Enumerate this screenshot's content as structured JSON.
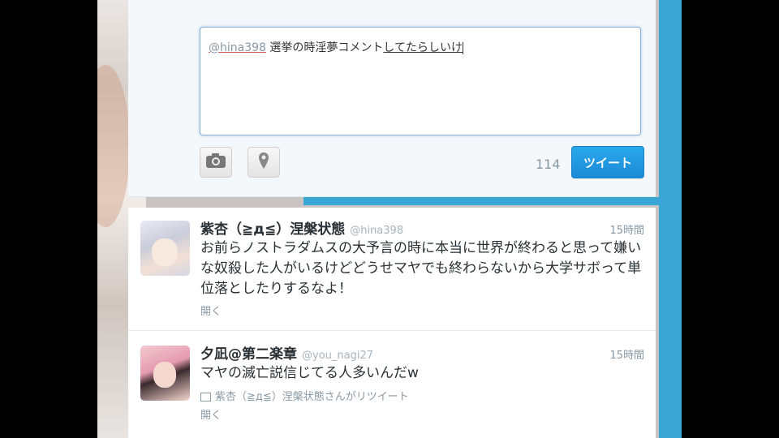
{
  "compose": {
    "mention": "@hina398",
    "text_plain": " 選挙の時淫夢コメント",
    "text_underlined": "してたらしいけ",
    "camera_icon": "camera-icon",
    "location_icon": "map-pin-icon",
    "char_count": "114",
    "tweet_button": "ツイート"
  },
  "tweets": [
    {
      "name": "紫杏（≧д≦）涅槃状態",
      "handle": "@hina398",
      "time": "15時間",
      "text": "お前らノストラダムスの大予言の時に本当に世界が終わると思って嫌いな奴殺した人がいるけどどうせマヤでも終わらないから大学サボって単位落としたりするなよ！",
      "expand": "開く"
    },
    {
      "name": "夕凪@第二楽章",
      "handle": "@you_nagi27",
      "time": "15時間",
      "text": "マヤの滅亡説信じてる人多いんだw",
      "retweet": "紫杏（≧д≦）涅槃状態さんがリツイート",
      "expand": "開く"
    }
  ],
  "colors": {
    "accent": "#1b8ad6",
    "strip": "#3aa6d6"
  }
}
